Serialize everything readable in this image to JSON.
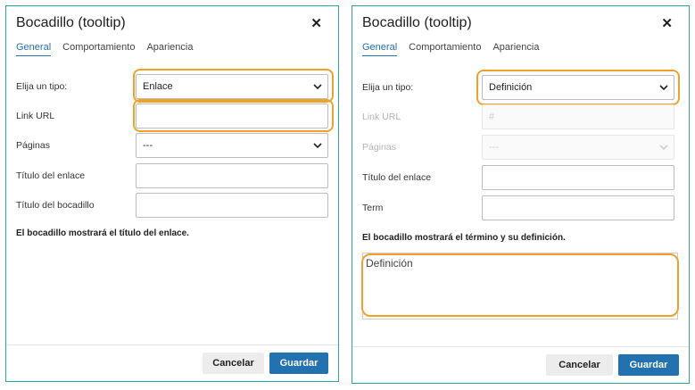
{
  "left": {
    "title": "Bocadillo (tooltip)",
    "close": "✕",
    "tabs": [
      "General",
      "Comportamiento",
      "Apariencia"
    ],
    "rows": [
      {
        "label": "Elija un tipo:",
        "value": "Enlace",
        "type": "select"
      },
      {
        "label": "Link URL",
        "value": "",
        "type": "text"
      },
      {
        "label": "Páginas",
        "value": "---",
        "type": "select"
      },
      {
        "label": "Título del enlace",
        "value": "",
        "type": "text"
      },
      {
        "label": "Título del bocadillo",
        "value": "",
        "type": "text"
      }
    ],
    "note": "El bocadillo mostrará el título del enlace.",
    "cancel": "Cancelar",
    "save": "Guardar"
  },
  "right": {
    "title": "Bocadillo (tooltip)",
    "close": "✕",
    "tabs": [
      "General",
      "Comportamiento",
      "Apariencia"
    ],
    "rows": [
      {
        "label": "Elija un tipo:",
        "value": "Definición",
        "type": "select"
      },
      {
        "label": "Link URL",
        "value": "#",
        "type": "text",
        "disabled": true
      },
      {
        "label": "Páginas",
        "value": "---",
        "type": "select",
        "disabled": true
      },
      {
        "label": "Título del enlace",
        "value": "",
        "type": "text"
      },
      {
        "label": "Term",
        "value": "",
        "type": "text"
      }
    ],
    "note": "El bocadillo mostrará el término y su definición.",
    "definition_placeholder": "Definición",
    "cancel": "Cancelar",
    "save": "Guardar"
  },
  "colors": {
    "accent": "#2271b1",
    "highlight": "#f0a12a",
    "border": "#2aa3a3"
  }
}
